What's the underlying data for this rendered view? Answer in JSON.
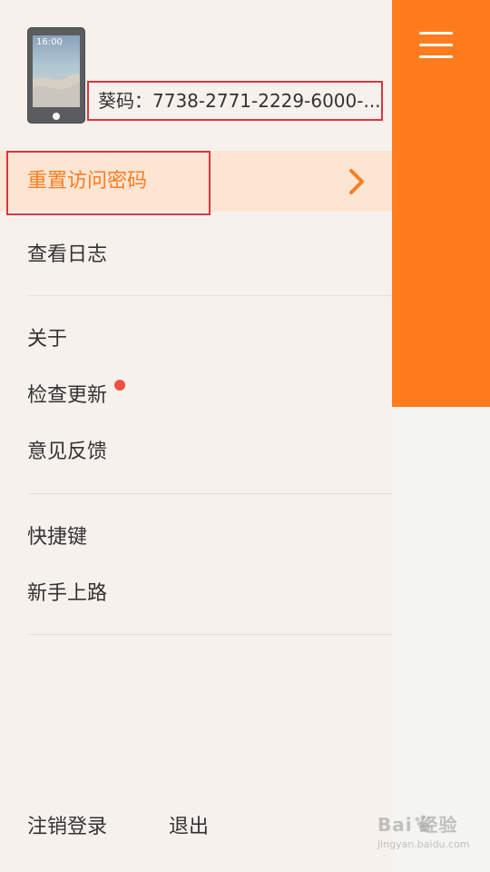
{
  "menu": {
    "icon": "menu-icon"
  },
  "header": {
    "device_time": "16:00",
    "code_text": "葵码：7738-2771-2229-6000-..."
  },
  "drawer": {
    "highlight_item": {
      "label": "重置访问密码",
      "icon": "chevron-right-icon"
    },
    "items_group_1": [
      {
        "label": "查看日志"
      }
    ],
    "items_group_2": [
      {
        "label": "关于"
      },
      {
        "label": "检查更新",
        "badge": "red-dot"
      },
      {
        "label": "意见反馈"
      }
    ],
    "items_group_3": [
      {
        "label": "快捷键"
      },
      {
        "label": "新手上路"
      }
    ],
    "bottom": {
      "logout": "注销登录",
      "exit": "退出"
    }
  },
  "watermark": {
    "main": "Bai 经验",
    "sub": "jingyan.baidu.com"
  },
  "colors": {
    "accent": "#ff7c1e",
    "highlight_bg": "#fde5d4",
    "drawer_bg": "#f6f1ed",
    "badge_red": "#ee5142",
    "box_red": "#d9363e"
  }
}
